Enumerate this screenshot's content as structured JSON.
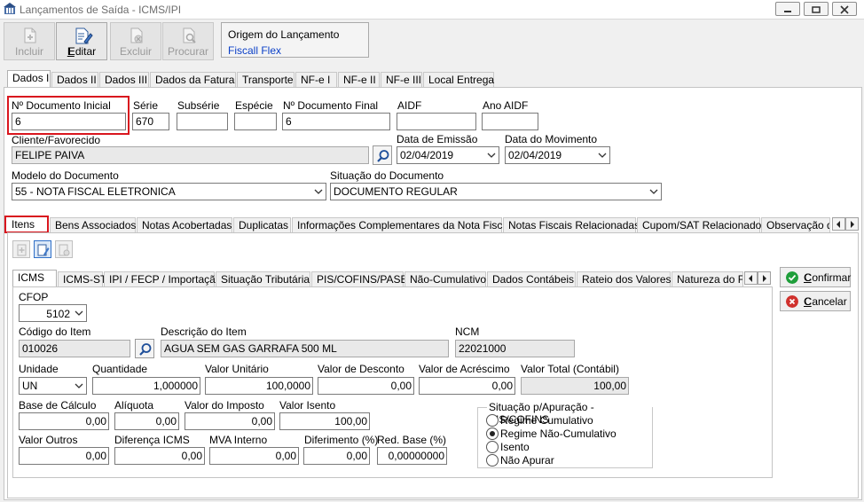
{
  "window": {
    "title": "Lançamentos de Saída - ICMS/IPI"
  },
  "toolbar": {
    "incluir": "Incluir",
    "editar": "Editar",
    "excluir": "Excluir",
    "procurar": "Procurar"
  },
  "origin": {
    "title": "Origem do Lançamento",
    "value": "Fiscall Flex"
  },
  "main_tabs": [
    "Dados I",
    "Dados II",
    "Dados III",
    "Dados da Fatura",
    "Transporte",
    "NF-e I",
    "NF-e II",
    "NF-e III",
    "Local Entrega"
  ],
  "header": {
    "num_doc_inicial_label": "Nº Documento Inicial",
    "num_doc_inicial": "6",
    "serie_label": "Série",
    "serie": "670",
    "subserie_label": "Subsérie",
    "subserie": "",
    "especie_label": "Espécie",
    "especie": "",
    "num_doc_final_label": "Nº Documento Final",
    "num_doc_final": "6",
    "aidf_label": "AIDF",
    "aidf": "",
    "ano_aidf_label": "Ano AIDF",
    "ano_aidf": "",
    "cliente_label": "Cliente/Favorecido",
    "cliente": "FELIPE PAIVA",
    "data_emissao_label": "Data de Emissão",
    "data_emissao": "02/04/2019",
    "data_movimento_label": "Data do Movimento",
    "data_movimento": "02/04/2019",
    "modelo_label": "Modelo do Documento",
    "modelo": "55 - NOTA FISCAL ELETRONICA",
    "situacao_label": "Situação do Documento",
    "situacao": "DOCUMENTO REGULAR"
  },
  "sub_tabs": [
    "Itens",
    "Bens Associados",
    "Notas Acobertadas",
    "Duplicatas",
    "Informações Complementares da Nota Fiscal",
    "Notas Fiscais Relacionadas",
    "Cupom/SAT Relacionados",
    "Observação d"
  ],
  "item_tabs": [
    "ICMS",
    "ICMS-ST",
    "IPI / FECP / Importação",
    "Situação Tributária",
    "PIS/COFINS/PASEP",
    "Não-Cumulativo",
    "Dados Contábeis",
    "Rateio dos Valores",
    "Natureza do Fr"
  ],
  "item": {
    "cfop_label": "CFOP",
    "cfop": "5102",
    "codigo_label": "Código do Item",
    "codigo": "010026",
    "descricao_label": "Descrição do Item",
    "descricao": "AGUA SEM GAS GARRAFA 500 ML",
    "ncm_label": "NCM",
    "ncm": "22021000",
    "unidade_label": "Unidade",
    "unidade": "UN",
    "quantidade_label": "Quantidade",
    "quantidade": "1,000000",
    "valor_unitario_label": "Valor Unitário",
    "valor_unitario": "100,0000",
    "valor_desconto_label": "Valor de Desconto",
    "valor_desconto": "0,00",
    "valor_acrescimo_label": "Valor de Acréscimo",
    "valor_acrescimo": "0,00",
    "valor_total_label": "Valor Total (Contábil)",
    "valor_total": "100,00",
    "base_calculo_label": "Base de Cálculo",
    "base_calculo": "0,00",
    "aliquota_label": "Alíquota",
    "aliquota": "0,00",
    "valor_imposto_label": "Valor do Imposto",
    "valor_imposto": "0,00",
    "valor_isento_label": "Valor Isento",
    "valor_isento": "100,00",
    "valor_outros_label": "Valor Outros",
    "valor_outros": "0,00",
    "diferenca_icms_label": "Diferença ICMS",
    "diferenca_icms": "0,00",
    "mva_label": "MVA Interno",
    "mva": "0,00",
    "diferimento_label": "Diferimento (%)",
    "diferimento": "0,00",
    "red_base_label": "Red. Base (%)",
    "red_base": "0,00000000"
  },
  "situacao_pis": {
    "title": "Situação p/Apuração - PIS/COFINS",
    "options": [
      "Regime Cumulativo",
      "Regime Não-Cumulativo",
      "Isento",
      "Não Apurar"
    ],
    "selected": "Regime Não-Cumulativo"
  },
  "actions": {
    "confirmar": "Confirmar",
    "cancelar": "Cancelar"
  },
  "colors": {
    "highlight": "#d9161e",
    "link": "#0a3fc7",
    "confirm": "#1e9e3a",
    "cancel": "#d0312d"
  }
}
